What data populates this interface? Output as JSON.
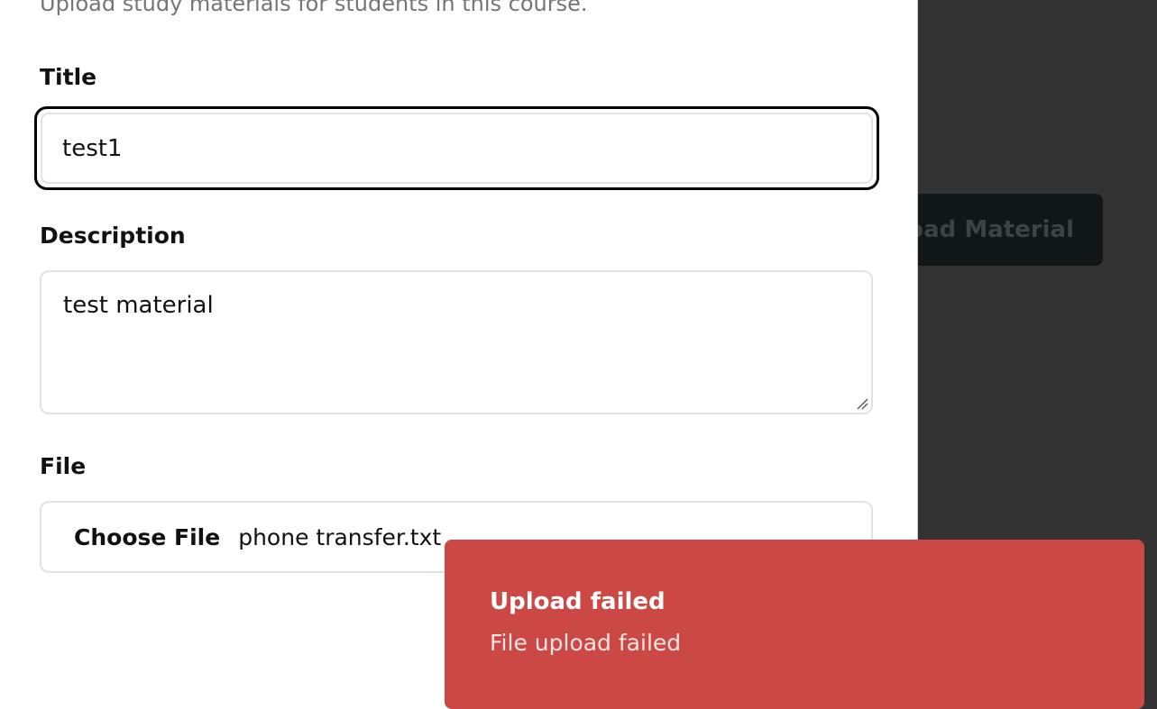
{
  "background": {
    "upload_button_label": "Upload Material"
  },
  "dialog": {
    "description": "Upload study materials for students in this course.",
    "title_label": "Title",
    "title_value": "test1",
    "description_label": "Description",
    "description_value": "test material",
    "file_label": "File",
    "choose_file_label": "Choose File",
    "file_name": "phone transfer.txt"
  },
  "toast": {
    "title": "Upload failed",
    "message": "File upload failed",
    "color": "#cc4844"
  }
}
